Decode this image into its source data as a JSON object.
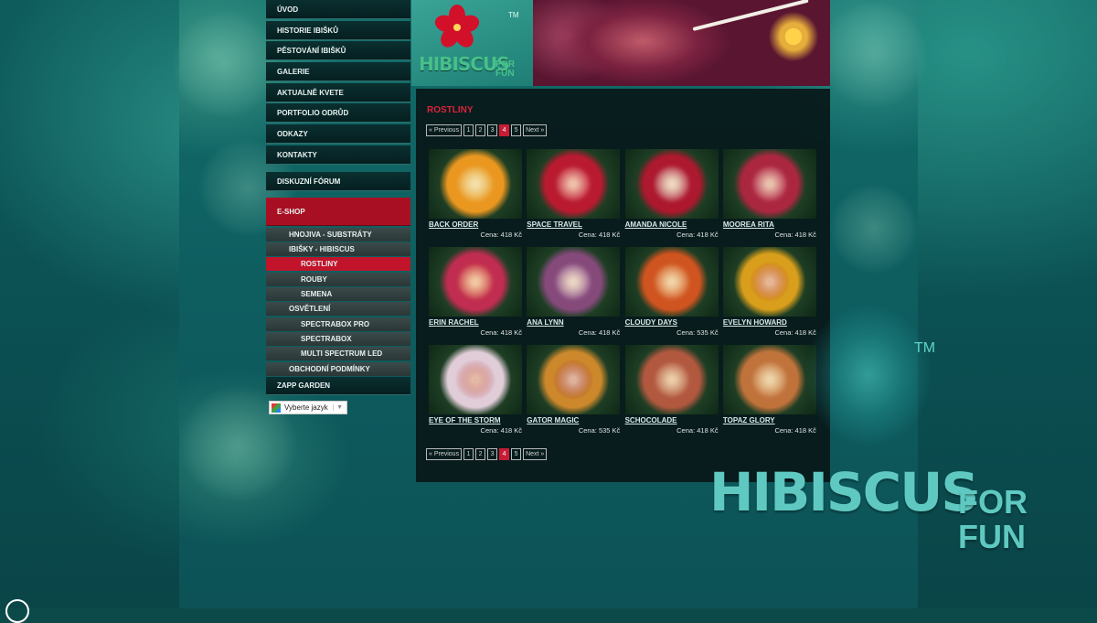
{
  "nav": {
    "items": [
      "ÚVOD",
      "HISTORIE IBIŠKŮ",
      "PĚSTOVÁNÍ IBIŠKŮ",
      "GALERIE",
      "AKTUALNĚ KVETE",
      "PORTFOLIO ODRŮD",
      "ODKAZY",
      "KONTAKTY"
    ],
    "forum": "DISKUZNÍ FÓRUM",
    "eshop": "E-SHOP",
    "sub": [
      {
        "label": "HNOJIVA - SUBSTRÁTY",
        "level": 1
      },
      {
        "label": "IBIŠKY - HIBISCUS",
        "level": 1
      },
      {
        "label": "ROSTLINY",
        "level": 2,
        "active": true
      },
      {
        "label": "ROUBY",
        "level": 2
      },
      {
        "label": "SEMENA",
        "level": 2
      },
      {
        "label": "OSVĚTLENÍ",
        "level": 1
      },
      {
        "label": "SPECTRABOX PRO",
        "level": 2
      },
      {
        "label": "SPECTRABOX",
        "level": 2
      },
      {
        "label": "MULTI SPECTRUM LED",
        "level": 2
      },
      {
        "label": "OBCHODNÍ PODMÍNKY",
        "level": 1
      }
    ],
    "zapp": "ZAPP GARDEN",
    "language": "Vyberte jazyk"
  },
  "header": {
    "logo_main": "HIBISCUS",
    "logo_for": "FOR",
    "logo_fun": "FUN",
    "logo_tm": "TM"
  },
  "page": {
    "title": "ROSTLINY",
    "pager": {
      "prev": "« Previous",
      "pages": [
        "1",
        "2",
        "3",
        "4",
        "5"
      ],
      "current": "4",
      "next": "Next »"
    }
  },
  "products": [
    {
      "name": "BACK ORDER",
      "price": "Cena: 418 Kč",
      "colors": [
        "#f39a1e",
        "#f7c96a"
      ]
    },
    {
      "name": "SPACE TRAVEL",
      "price": "Cena: 418 Kč",
      "colors": [
        "#c0182e",
        "#e95a6a"
      ]
    },
    {
      "name": "AMANDA NICOLE",
      "price": "Cena: 418 Kč",
      "colors": [
        "#b4162c",
        "#e0b4b9"
      ]
    },
    {
      "name": "MOOREA RITA",
      "price": "Cena: 418 Kč",
      "colors": [
        "#b2253f",
        "#d8607a"
      ]
    },
    {
      "name": "ERIN RACHEL",
      "price": "Cena: 418 Kč",
      "colors": [
        "#c82c50",
        "#f07a4a"
      ]
    },
    {
      "name": "ANA LYNN",
      "price": "Cena: 418 Kč",
      "colors": [
        "#8a4a7c",
        "#d9a6c8"
      ]
    },
    {
      "name": "CLOUDY DAYS",
      "price": "Cena: 535 Kč",
      "colors": [
        "#d8541e",
        "#f0a060"
      ]
    },
    {
      "name": "EVELYN HOWARD",
      "price": "Cena: 418 Kč",
      "colors": [
        "#e2a21a",
        "#c4302a"
      ]
    },
    {
      "name": "EYE OF THE STORM",
      "price": "Cena: 418 Kč",
      "colors": [
        "#e9d2dc",
        "#c0384c"
      ]
    },
    {
      "name": "GATOR MAGIC",
      "price": "Cena: 535 Kč",
      "colors": [
        "#d48a2a",
        "#a8243a"
      ]
    },
    {
      "name": "SCHOCOLADE",
      "price": "Cena: 418 Kč",
      "colors": [
        "#b8583e",
        "#d88a6a"
      ]
    },
    {
      "name": "TOPAZ GLORY",
      "price": "Cena: 418 Kč",
      "colors": [
        "#c8743a",
        "#e5a36a"
      ]
    }
  ],
  "brand": {
    "text": "HIBISCUS",
    "for": "FOR",
    "fun": "FUN",
    "tm": "TM"
  }
}
